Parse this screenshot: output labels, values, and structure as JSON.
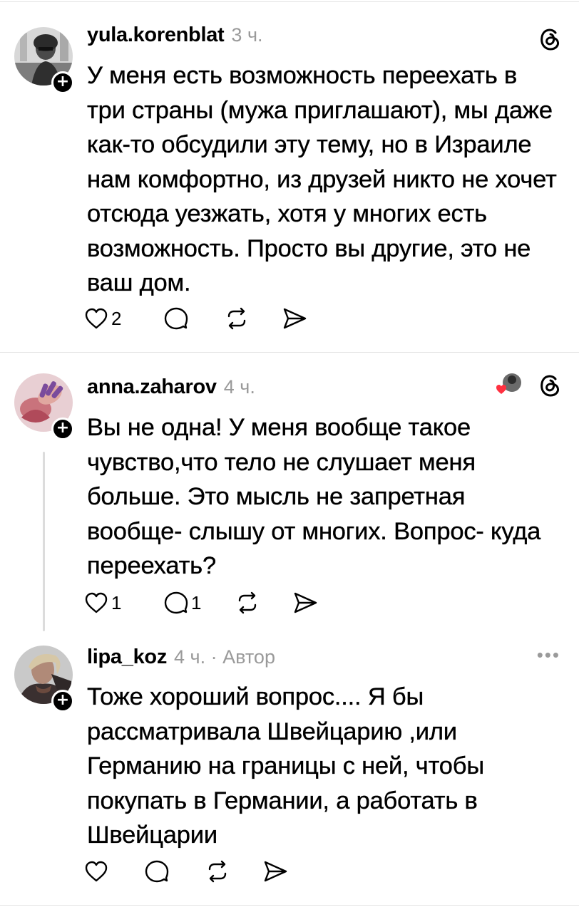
{
  "posts": [
    {
      "username": "yula.korenblat",
      "time": "3 ч.",
      "text": "У меня есть возможность переехать в три страны (мужа приглашают), мы даже как-то обсудили эту тему, но в Израиле нам комфортно, из друзей никто не хочет отсюда уезжать, хотя у многих есть возможность. Просто вы другие, это не ваш дом.",
      "likes": "2",
      "replies": ""
    },
    {
      "username": "anna.zaharov",
      "time": "4 ч.",
      "text": "Вы не одна! У меня вообще такое чувство,что тело не слушает меня больше. Это мысль не запретная вообще- слышу от многих. Вопрос- куда переехать?",
      "likes": "1",
      "replies": "1"
    },
    {
      "username": "lipa_koz",
      "time": "4 ч. · Автор",
      "text": "Тоже хороший вопрос.... Я бы рассматривала Швейцарию ,или Германию на границы с ней, чтобы покупать в Германии, а работать в Швейцарии",
      "likes": "",
      "replies": ""
    }
  ],
  "icons": {
    "like": "heart-icon",
    "reply": "comment-icon",
    "repost": "repost-icon",
    "share": "send-icon",
    "app": "threads-logo-icon",
    "more": "more-icon",
    "follow": "plus-icon"
  },
  "colors": {
    "text": "#000000",
    "secondary": "#9a9a9a",
    "divider": "#e3e3e3",
    "like_red": "#ff3040"
  }
}
